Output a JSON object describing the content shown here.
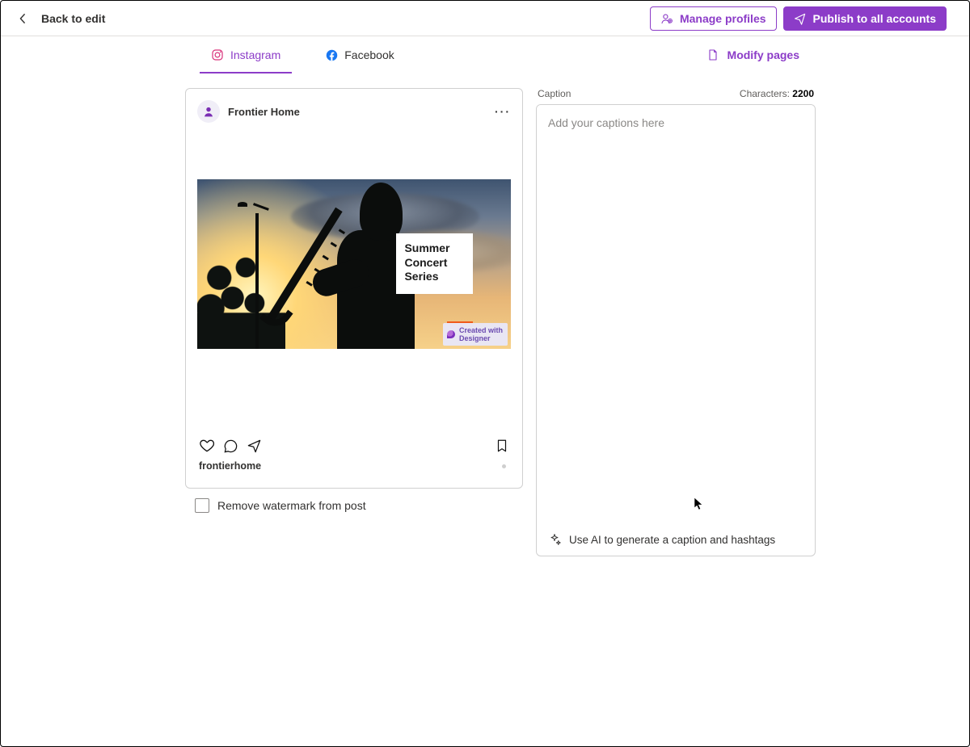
{
  "header": {
    "back_label": "Back to edit",
    "manage_label": "Manage profiles",
    "publish_label": "Publish to all accounts"
  },
  "tabs": {
    "instagram": "Instagram",
    "facebook": "Facebook",
    "modify": "Modify pages"
  },
  "preview": {
    "profile_name": "Frontier Home",
    "handle": "frontierhome",
    "post_title_line1": "Summer",
    "post_title_line2": "Concert",
    "post_title_line3": "Series",
    "badge_line1": "Created with",
    "badge_line2": "Designer"
  },
  "caption": {
    "label": "Caption",
    "counter_label": "Characters:",
    "counter_value": "2200",
    "placeholder": "Add your captions here",
    "ai_prompt": "Use AI to generate a caption and hashtags"
  },
  "watermark_label": "Remove watermark from post"
}
